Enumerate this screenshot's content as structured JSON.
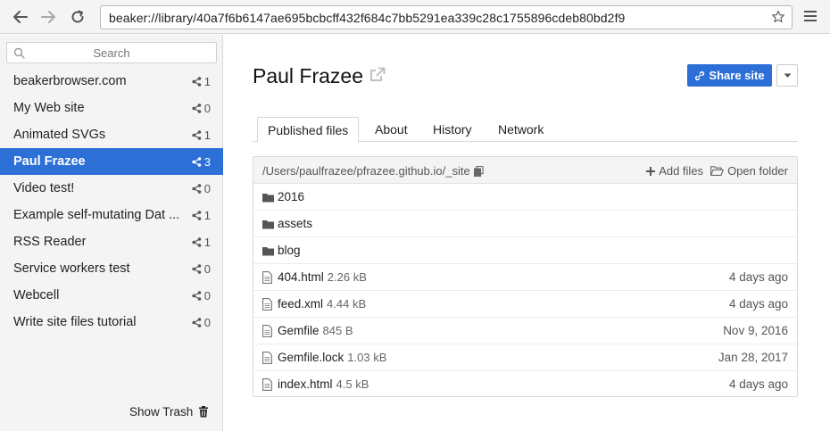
{
  "browser": {
    "url": "beaker://library/40a7f6b6147ae695bcbcff432f684c7bb5291ea339c28c1755896cdeb80bd2f9"
  },
  "sidebar": {
    "search_placeholder": "Search",
    "items": [
      {
        "name": "beakerbrowser.com",
        "count": "1"
      },
      {
        "name": "My Web site",
        "count": "0"
      },
      {
        "name": "Animated SVGs",
        "count": "1"
      },
      {
        "name": "Paul Frazee",
        "count": "3",
        "active": true
      },
      {
        "name": "Video test!",
        "count": "0"
      },
      {
        "name": "Example self-mutating Dat ...",
        "count": "1"
      },
      {
        "name": "RSS Reader",
        "count": "1"
      },
      {
        "name": "Service workers test",
        "count": "0"
      },
      {
        "name": "Webcell",
        "count": "0"
      },
      {
        "name": "Write site files tutorial",
        "count": "0"
      }
    ],
    "show_trash_label": "Show Trash"
  },
  "main": {
    "title": "Paul Frazee",
    "share_label": "Share site",
    "tabs": [
      {
        "label": "Published files",
        "active": true
      },
      {
        "label": "About"
      },
      {
        "label": "History"
      },
      {
        "label": "Network"
      }
    ],
    "files": {
      "path": "/Users/paulfrazee/pfrazee.github.io/_site",
      "add_files_label": "Add files",
      "open_folder_label": "Open folder",
      "rows": [
        {
          "type": "folder",
          "name": "2016",
          "size": "",
          "date": ""
        },
        {
          "type": "folder",
          "name": "assets",
          "size": "",
          "date": ""
        },
        {
          "type": "folder",
          "name": "blog",
          "size": "",
          "date": ""
        },
        {
          "type": "file",
          "name": "404.html",
          "size": "2.26 kB",
          "date": "4 days ago"
        },
        {
          "type": "file",
          "name": "feed.xml",
          "size": "4.44 kB",
          "date": "4 days ago"
        },
        {
          "type": "file",
          "name": "Gemfile",
          "size": "845 B",
          "date": "Nov 9, 2016"
        },
        {
          "type": "file",
          "name": "Gemfile.lock",
          "size": "1.03 kB",
          "date": "Jan 28, 2017"
        },
        {
          "type": "file",
          "name": "index.html",
          "size": "4.5 kB",
          "date": "4 days ago"
        }
      ]
    }
  },
  "colors": {
    "accent": "#2c6fd6",
    "sidebar_bg": "#f4f4f4"
  }
}
